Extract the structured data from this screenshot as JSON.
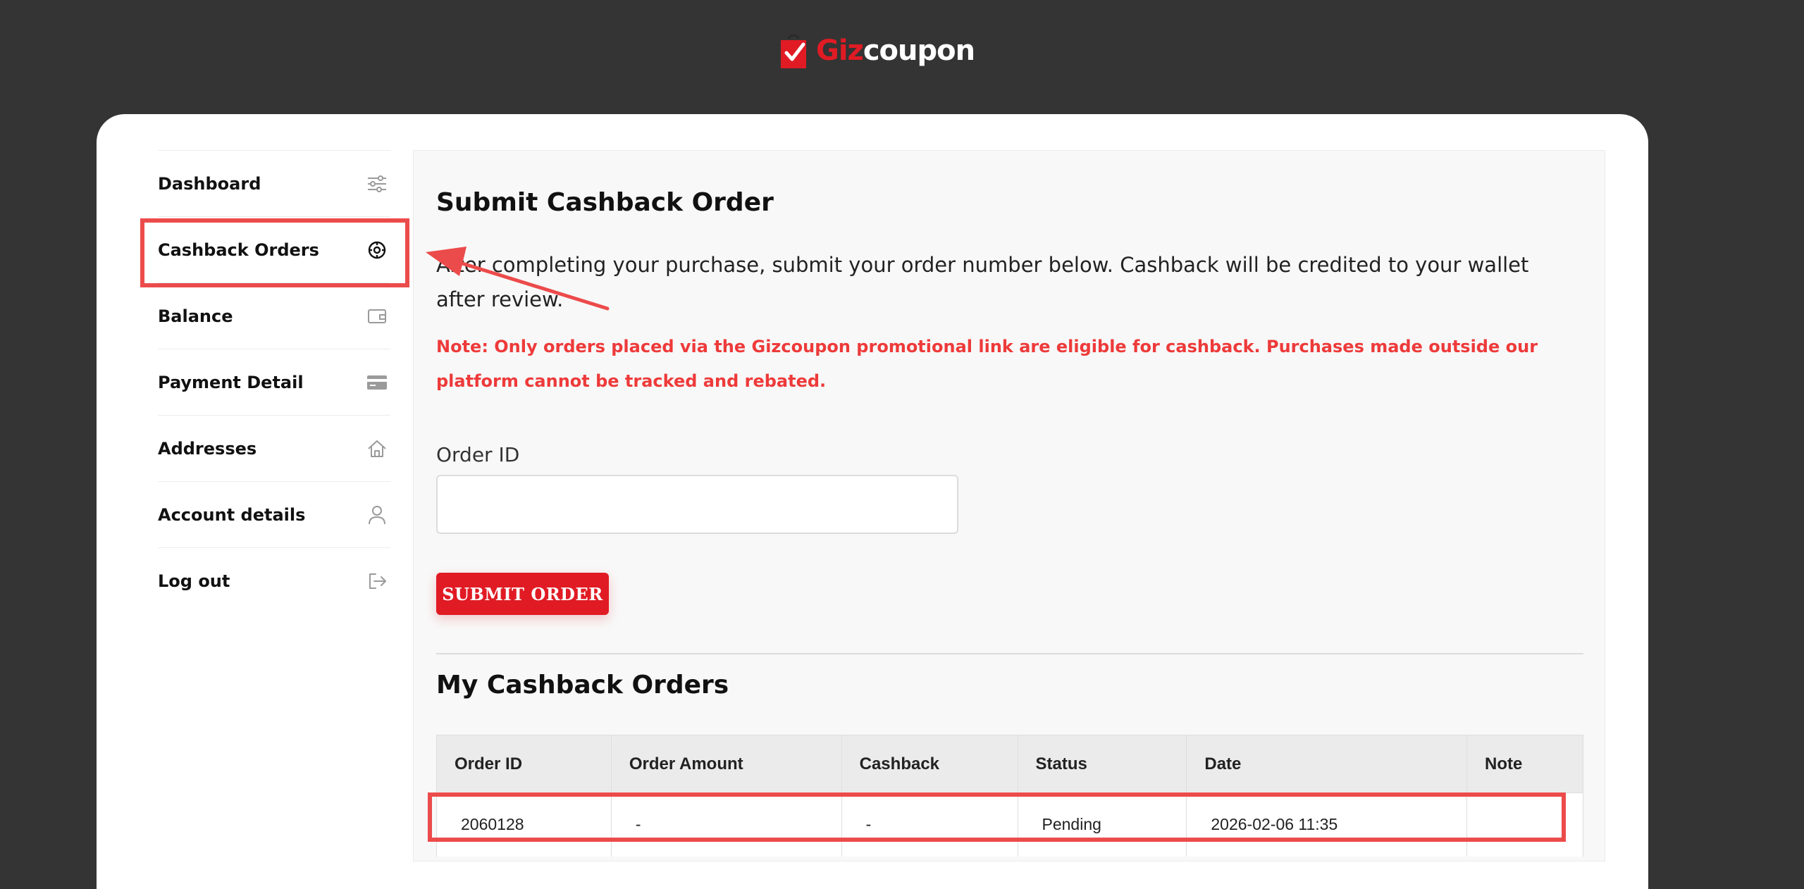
{
  "brand": {
    "name_part1": "Giz",
    "name_part2": "coupon",
    "colors": {
      "brand_red": "#e01b24",
      "accent_warning": "#ee3a3a",
      "pending": "#e8871e",
      "annotation": "#ec4b4b"
    }
  },
  "sidebar": {
    "items": [
      {
        "label": "Dashboard",
        "icon": "sliders-icon"
      },
      {
        "label": "Cashback Orders",
        "icon": "gear-badge-icon",
        "active": true
      },
      {
        "label": "Balance",
        "icon": "wallet-icon"
      },
      {
        "label": "Payment Detail",
        "icon": "credit-card-icon"
      },
      {
        "label": "Addresses",
        "icon": "home-icon"
      },
      {
        "label": "Account details",
        "icon": "user-icon"
      },
      {
        "label": "Log out",
        "icon": "logout-icon"
      }
    ]
  },
  "main": {
    "title": "Submit Cashback Order",
    "intro": "After completing your purchase, submit your order number below. Cashback will be credited to your wallet after review.",
    "note": "Note: Only orders placed via the Gizcoupon promotional link are eligible for cashback. Purchases made outside our platform cannot be tracked and rebated.",
    "order_id_label": "Order ID",
    "order_id_value": "",
    "submit_label": "SUBMIT ORDER",
    "orders_title": "My Cashback Orders",
    "table": {
      "headers": [
        "Order ID",
        "Order Amount",
        "Cashback",
        "Status",
        "Date",
        "Note"
      ],
      "rows": [
        {
          "order_id": "2060128",
          "amount": "-",
          "cashback": "-",
          "status": "Pending",
          "date": "2026-02-06 11:35",
          "note": ""
        }
      ]
    }
  }
}
